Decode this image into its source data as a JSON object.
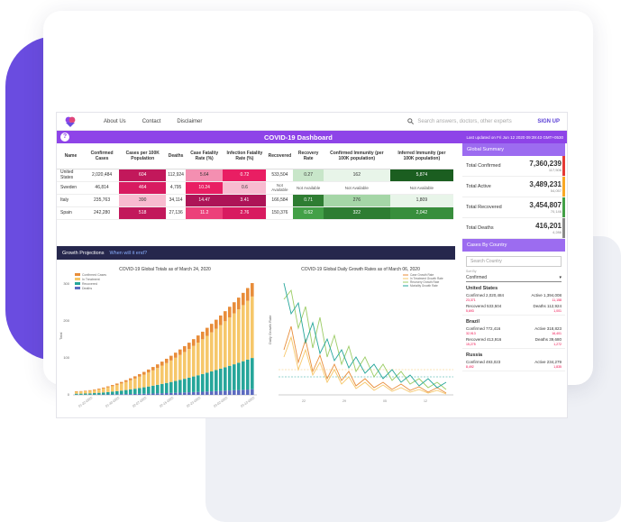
{
  "nav": {
    "about": "About Us",
    "contact": "Contact",
    "disclaimer": "Disclaimer",
    "search_placeholder": "Search answers, doctors, other experts",
    "signup": "SIGN UP"
  },
  "dashboard": {
    "title": "COVID-19 Dashboard",
    "updated": "Last updated on Fri Jun 12 2020 09:39:43 GMT+0530",
    "help": "?"
  },
  "table": {
    "headers": [
      "Name",
      "Confirmed Cases",
      "Cases per 100K Population",
      "Deaths",
      "Case Fatality Rate (%)",
      "Infection Fatality Rate (%)",
      "Recovered",
      "Recovery Rate",
      "Confirmed Immunity (per 100K population)",
      "Inferred Immunity (per 100K population)"
    ],
    "rows": [
      {
        "name": "United States",
        "confirmed": "2,020,484",
        "per100k": "604",
        "deaths": "112,924",
        "cfr": "5.64",
        "ifr": "0.72",
        "recovered": "533,504",
        "rate": "0.27",
        "conf_imm": "162",
        "inf_imm": "5,874"
      },
      {
        "name": "Sweden",
        "confirmed": "46,814",
        "per100k": "464",
        "deaths": "4,795",
        "cfr": "10.24",
        "ifr": "0.6",
        "recovered": "Not Available",
        "rate": "Not Available",
        "conf_imm": "Not Available",
        "inf_imm": "Not Available"
      },
      {
        "name": "Italy",
        "confirmed": "235,763",
        "per100k": "390",
        "deaths": "34,114",
        "cfr": "14.47",
        "ifr": "3.41",
        "recovered": "166,584",
        "rate": "0.71",
        "conf_imm": "276",
        "inf_imm": "1,809"
      },
      {
        "name": "Spain",
        "confirmed": "242,280",
        "per100k": "518",
        "deaths": "27,136",
        "cfr": "11.2",
        "ifr": "2.76",
        "recovered": "150,376",
        "rate": "0.62",
        "conf_imm": "322",
        "inf_imm": "2,042"
      }
    ]
  },
  "growth": {
    "title": "Growth Projections",
    "question": "When will it end?"
  },
  "chart1": {
    "title": "COVID-19 Global Totals as of March 24, 2020",
    "legend": [
      "Confirmed Cases",
      "In Treatment",
      "Recovered",
      "Deaths"
    ],
    "yticks": [
      "0",
      "100",
      "200",
      "300"
    ],
    "ylabel": "Total"
  },
  "chart2": {
    "title": "COVID-19 Global Daily Growth Rates as of March 06, 2020",
    "legend": [
      "Case Growth Rate",
      "In Treatment Growth Rate",
      "Recovery Growth Rate",
      "Mortality Growth Rate"
    ],
    "ylabel": "Daily Growth Rate"
  },
  "summary": {
    "head": "Global Summary",
    "items": [
      {
        "label": "Total Confirmed",
        "value": "7,360,239",
        "change": "117,506",
        "color": "#e53935"
      },
      {
        "label": "Total Active",
        "value": "3,489,231",
        "change": "54,057",
        "color": "#f9a825"
      },
      {
        "label": "Total Recovered",
        "value": "3,454,807",
        "change": "70,146",
        "color": "#43a047"
      },
      {
        "label": "Total Deaths",
        "value": "416,201",
        "change": "4,286",
        "color": "#888888"
      }
    ]
  },
  "by_country": {
    "head": "Cases By Country",
    "search_placeholder": "Search Country",
    "sort_label": "Sort By",
    "sort_value": "Confirmed",
    "countries": [
      {
        "name": "United States",
        "confirmed": "Confirmed 2,020,484",
        "active": "Active 1,394,008",
        "c_chg": "23,371",
        "a_chg": "11,158",
        "recovered": "Recovered 533,504",
        "deaths": "Deaths 112,924",
        "r_chg": "5,693",
        "d_chg": "1,001"
      },
      {
        "name": "Brazil",
        "confirmed": "Confirmed 772,416",
        "active": "Active 318,823",
        "c_chg": "32,913",
        "a_chg": "16,401",
        "recovered": "Recovered 413,916",
        "deaths": "Deaths 39,680",
        "r_chg": "15,275",
        "d_chg": "1,272"
      },
      {
        "name": "Russia",
        "confirmed": "Confirmed 493,023",
        "active": "Active 234,279",
        "c_chg": "8,492",
        "a_chg": "1,835"
      }
    ]
  },
  "colors": {
    "accent": "#8e44e8",
    "navy": "#26274d"
  }
}
